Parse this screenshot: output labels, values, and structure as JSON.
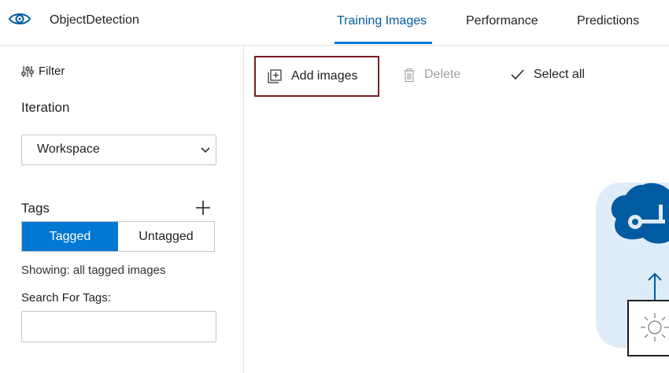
{
  "app": {
    "title": "ObjectDetection"
  },
  "tabs": [
    {
      "label": "Training Images",
      "active": true
    },
    {
      "label": "Performance",
      "active": false
    },
    {
      "label": "Predictions",
      "active": false
    }
  ],
  "sidebar": {
    "filter_label": "Filter",
    "iteration_title": "Iteration",
    "iteration_selected": "Workspace",
    "tags_title": "Tags",
    "tag_segments": [
      "Tagged",
      "Untagged"
    ],
    "showing_text": "Showing: all tagged images",
    "search_label": "Search For Tags:",
    "search_value": ""
  },
  "toolbar": {
    "add_images": "Add images",
    "delete": "Delete",
    "select_all": "Select all"
  },
  "colors": {
    "accent": "#0078d4",
    "active_tab_text": "#005ba1",
    "highlight_border": "#7a1c22",
    "illustration_bg": "#deecf9"
  },
  "icons": [
    "eye-logo-icon",
    "filter-icon",
    "chevron-down-icon",
    "plus-icon",
    "add-image-icon",
    "trash-icon",
    "checkmark-icon"
  ]
}
